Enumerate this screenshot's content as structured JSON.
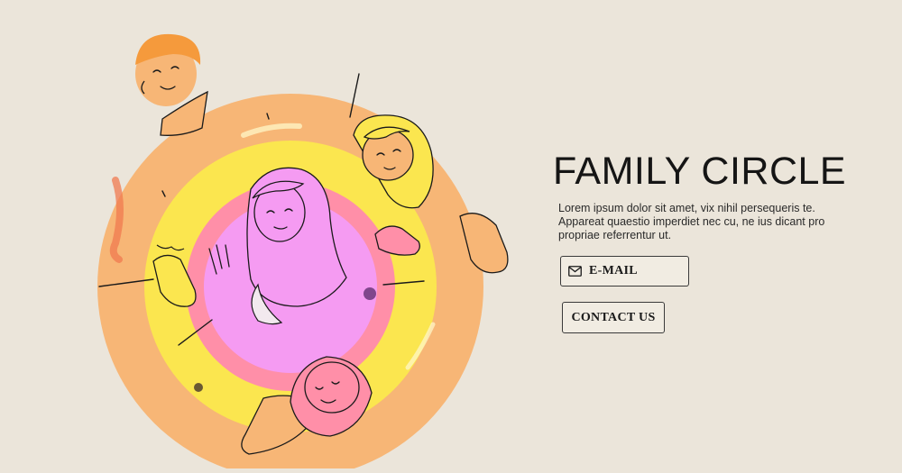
{
  "hero": {
    "title": "FAMILY CIRCLE",
    "description": "Lorem ipsum dolor sit amet, vix nihil persequeris te. Appareat quaestio imperdiet nec cu, ne ius dicant pro propriae referrentur ut."
  },
  "form": {
    "email_placeholder": "E-MAIL",
    "email_icon": "envelope-icon",
    "contact_label": "CONTACT US"
  },
  "colors": {
    "background": "#ebe5da",
    "ring_outer": "#f7b676",
    "ring_yellow": "#fbe64f",
    "ring_pink": "#ff8fa8",
    "ring_inner": "#f59bf2",
    "ink": "#151515"
  }
}
